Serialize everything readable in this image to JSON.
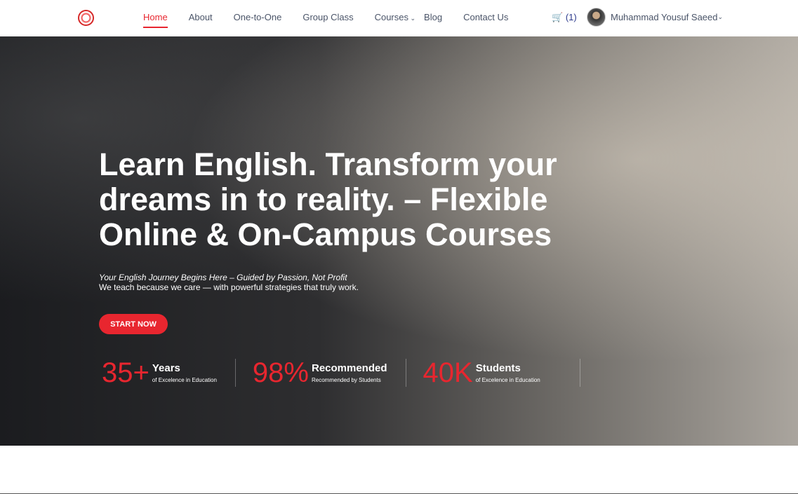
{
  "nav": {
    "items": [
      "Home",
      "About",
      "One-to-One",
      "Group Class",
      "Courses",
      "Blog",
      "Contact Us"
    ],
    "cart_count": "(1)",
    "user_name": "Muhammad Yousuf Saeed"
  },
  "hero": {
    "title": "Learn English. Transform your dreams in to reality. – Flexible Online & On-Campus Courses",
    "tagline": "Your English Journey Begins Here – Guided by Passion, Not Profit",
    "subtitle": "We teach because we care — with powerful strategies that truly work.",
    "cta": "START NOW",
    "stats": [
      {
        "value": "35+",
        "label": "Years",
        "caption": "of Excelence in Education"
      },
      {
        "value": "98%",
        "label": "Recommended",
        "caption": "Recommended by Students"
      },
      {
        "value": "40K",
        "label": "Students",
        "caption": "of Excelence in Education"
      }
    ]
  },
  "colors": {
    "accent": "#e8262f",
    "cart": "#2c3a8c"
  }
}
